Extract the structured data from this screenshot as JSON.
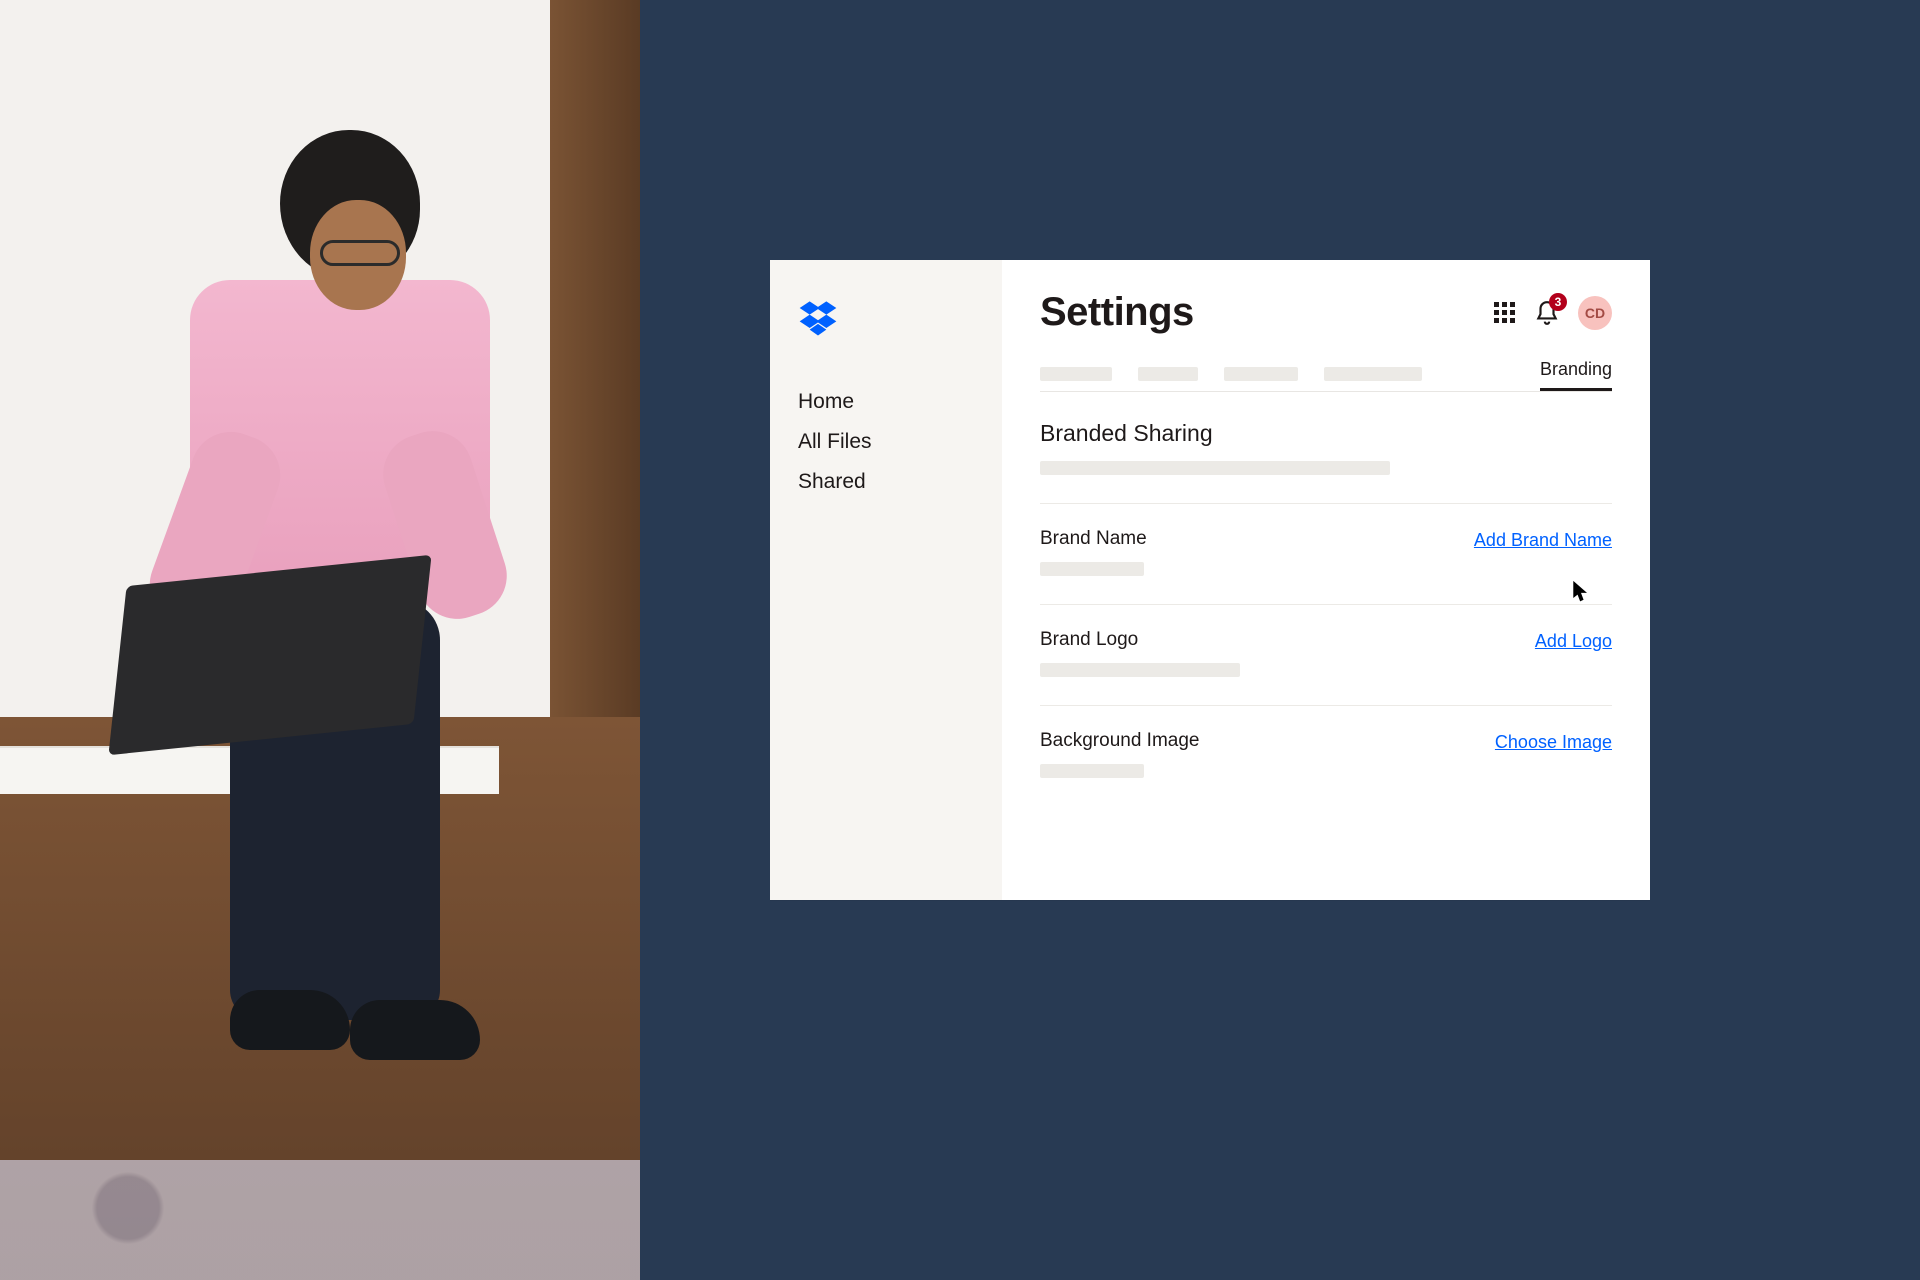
{
  "sidebar": {
    "items": [
      {
        "label": "Home"
      },
      {
        "label": "All Files"
      },
      {
        "label": "Shared"
      }
    ]
  },
  "header": {
    "title": "Settings",
    "notification_count": "3",
    "avatar_initials": "CD"
  },
  "tabs": {
    "active_label": "Branding"
  },
  "section": {
    "title": "Branded Sharing",
    "rows": [
      {
        "label": "Brand Name",
        "action": "Add Brand Name"
      },
      {
        "label": "Brand Logo",
        "action": "Add Logo"
      },
      {
        "label": "Background Image",
        "action": "Choose Image"
      }
    ]
  },
  "colors": {
    "accent": "#0061ff",
    "navy": "#283a53",
    "badge": "#b3001b"
  }
}
